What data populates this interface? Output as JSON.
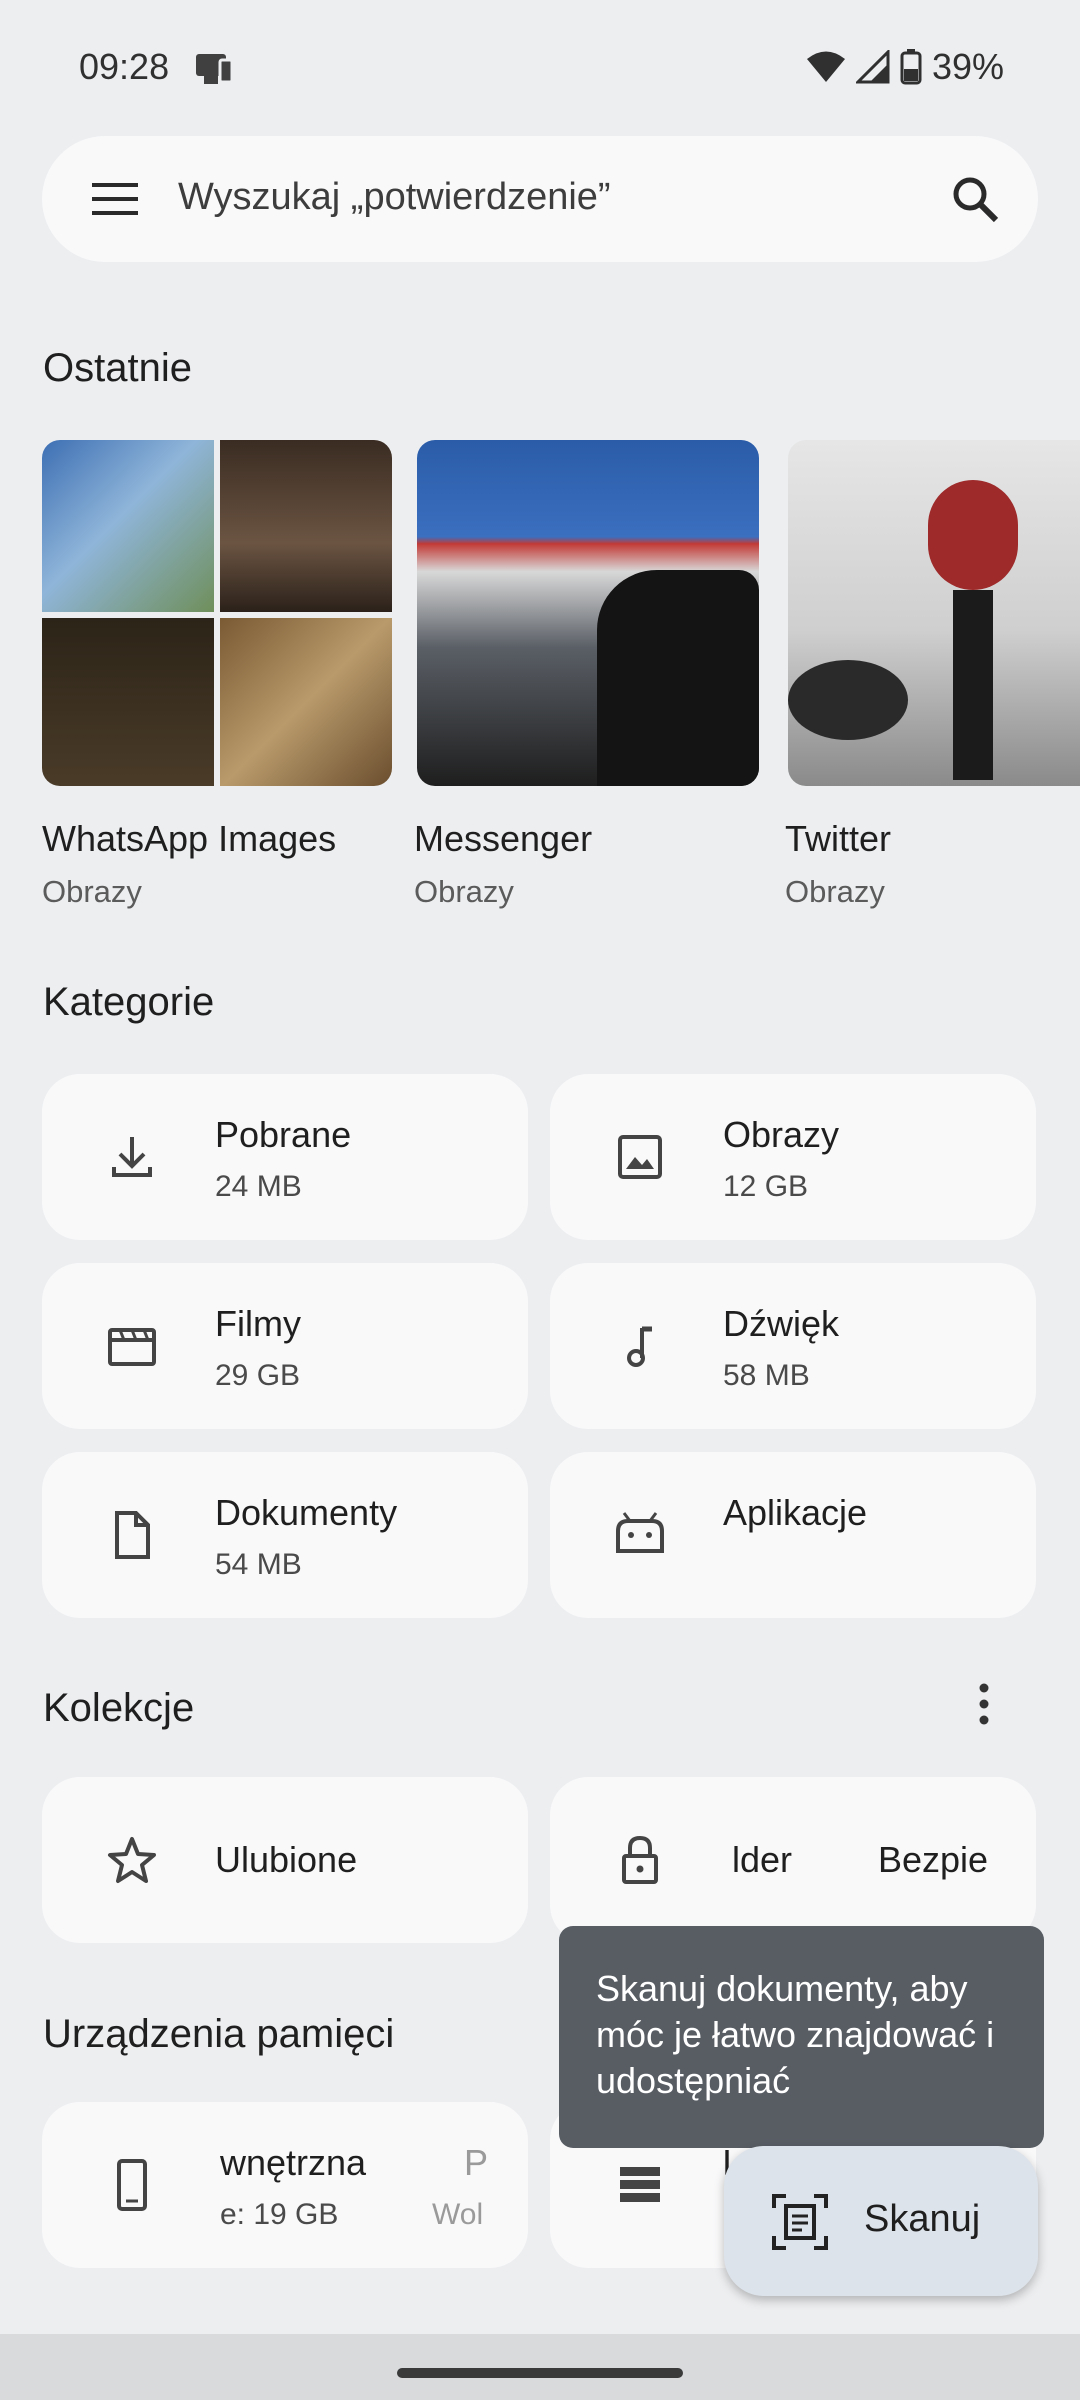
{
  "status_bar": {
    "time": "09:28",
    "battery": "39%"
  },
  "search": {
    "placeholder": "Wyszukaj „potwierdzenie”"
  },
  "recent": {
    "title": "Ostatnie",
    "items": [
      {
        "name": "WhatsApp Images",
        "type": "Obrazy"
      },
      {
        "name": "Messenger",
        "type": "Obrazy"
      },
      {
        "name": "Twitter",
        "type": "Obrazy"
      }
    ]
  },
  "categories": {
    "title": "Kategorie",
    "items": [
      {
        "label": "Pobrane",
        "size": "24 MB",
        "icon": "download-icon"
      },
      {
        "label": "Obrazy",
        "size": "12 GB",
        "icon": "image-icon"
      },
      {
        "label": "Filmy",
        "size": "29 GB",
        "icon": "movie-icon"
      },
      {
        "label": "Dźwięk",
        "size": "58 MB",
        "icon": "music-note-icon"
      },
      {
        "label": "Dokumenty",
        "size": "54 MB",
        "icon": "document-icon"
      },
      {
        "label": "Aplikacje",
        "size": "",
        "icon": "android-icon"
      }
    ]
  },
  "collections": {
    "title": "Kolekcje",
    "items": [
      {
        "label": "Ulubione",
        "icon": "star-icon"
      },
      {
        "label_a": "lder",
        "label_b": "Bezpie",
        "icon": "lock-icon"
      }
    ]
  },
  "storage": {
    "title": "Urządzenia pamięci",
    "items": [
      {
        "label": "wnętrzna",
        "sub": "e: 19 GB",
        "label2": "P",
        "sub2": "Wol",
        "icon": "phone-icon"
      },
      {
        "label": "I",
        "icon": "storage-icon"
      }
    ]
  },
  "tooltip": {
    "text": "Skanuj dokumenty, aby móc je łatwo znajdować i udostępniać"
  },
  "fab": {
    "label": "Skanuj"
  }
}
